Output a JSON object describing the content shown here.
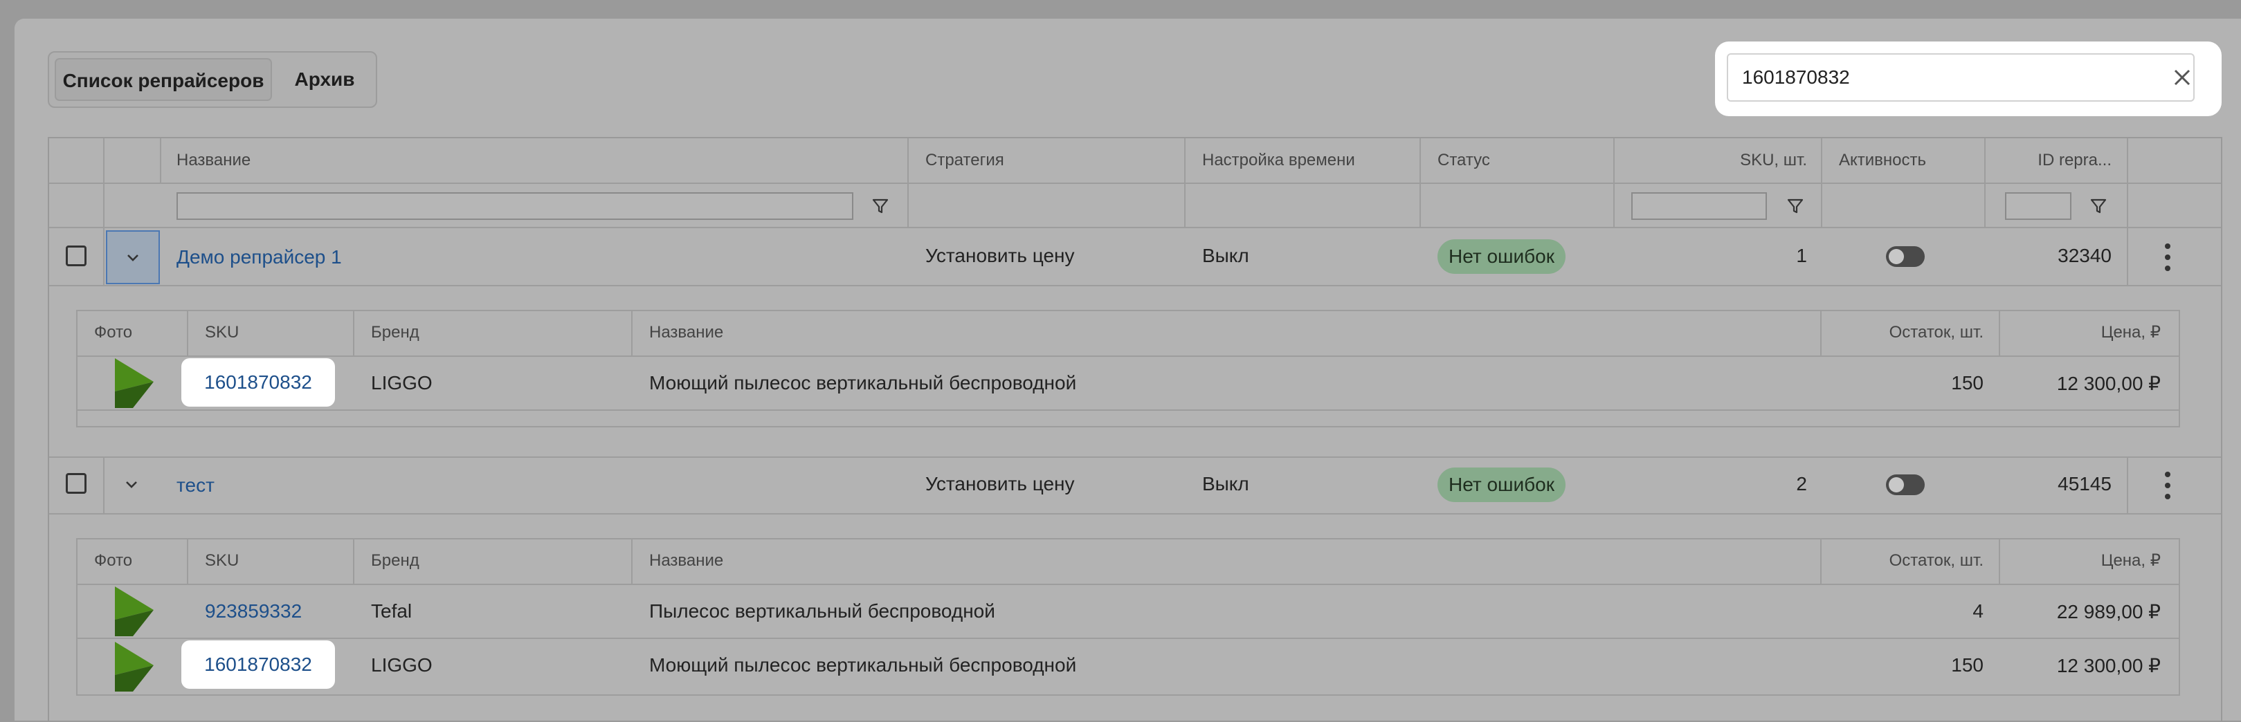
{
  "tabs": [
    {
      "label": "Список репрайсеров",
      "active": true
    },
    {
      "label": "Архив",
      "active": false
    }
  ],
  "search": {
    "value": "1601870832",
    "placeholder": ""
  },
  "columns": {
    "name": "Название",
    "strategy": "Стратегия",
    "time_setting": "Настройка времени",
    "status": "Статус",
    "sku_count": "SKU, шт.",
    "activity": "Активность",
    "id": "ID repra..."
  },
  "repricers": [
    {
      "name": "Демо репрайсер 1",
      "strategy": "Установить цену",
      "time_setting": "Выкл",
      "status": "Нет ошибок",
      "sku_count": "1",
      "active": false,
      "id": "32340",
      "expanded": true,
      "products": [
        {
          "sku": "1601870832",
          "brand": "LIGGO",
          "name": "Моющий пылесос вертикальный беспроводной",
          "stock": "150",
          "price": "12 300,00 ₽",
          "highlight": true
        }
      ]
    },
    {
      "name": "тест",
      "strategy": "Установить цену",
      "time_setting": "Выкл",
      "status": "Нет ошибок",
      "sku_count": "2",
      "active": false,
      "id": "45145",
      "expanded": true,
      "products": [
        {
          "sku": "923859332",
          "brand": "Tefal",
          "name": "Пылесос вертикальный беспроводной",
          "stock": "4",
          "price": "22 989,00 ₽",
          "highlight": false
        },
        {
          "sku": "1601870832",
          "brand": "LIGGO",
          "name": "Моющий пылесос вертикальный беспроводной",
          "stock": "150",
          "price": "12 300,00 ₽",
          "highlight": true
        }
      ]
    }
  ],
  "sub_columns": {
    "photo": "Фото",
    "sku": "SKU",
    "brand": "Бренд",
    "name": "Название",
    "stock": "Остаток, шт.",
    "price": "Цена, ₽"
  },
  "colors": {
    "accent_link": "#1d4f8a",
    "status_badge": "#86ab8b",
    "highlight": "#ffffff"
  },
  "icons": {
    "clear": "close-icon",
    "filter": "funnel-icon",
    "expand": "chevron-down-icon",
    "menu": "kebab-icon",
    "product_logo": "play-logo-icon"
  }
}
